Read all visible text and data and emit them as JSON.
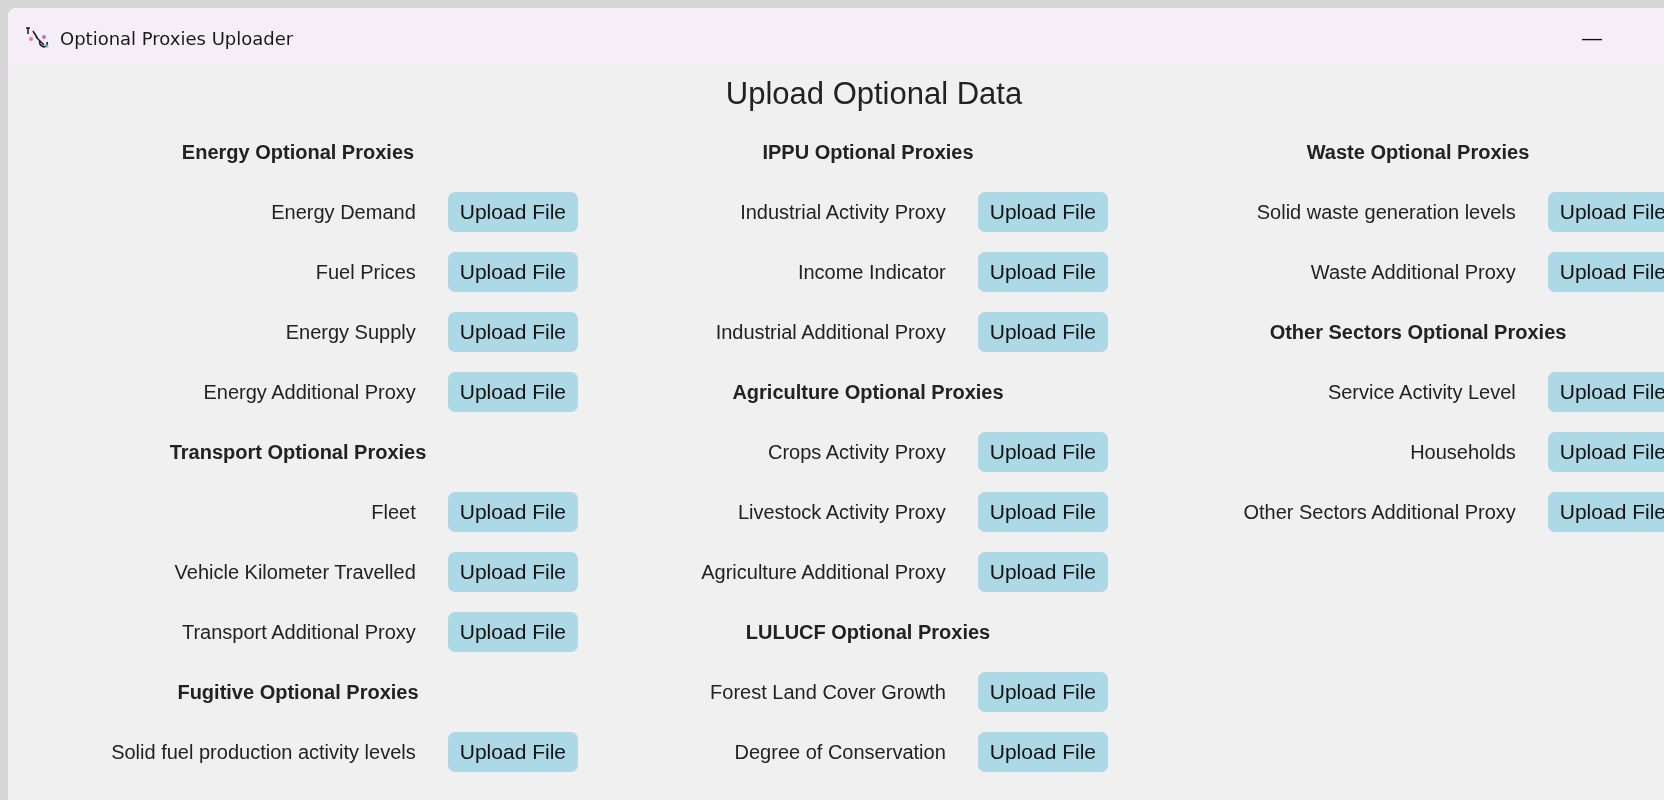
{
  "window": {
    "title": "Optional Proxies Uploader",
    "minimize_button": "—"
  },
  "heading": "Upload Optional Data",
  "columns": [
    [
      {
        "kind": "header",
        "text": "Energy Optional Proxies"
      },
      {
        "kind": "row",
        "label": "Energy Demand",
        "button": "Upload File"
      },
      {
        "kind": "row",
        "label": "Fuel Prices",
        "button": "Upload File"
      },
      {
        "kind": "row",
        "label": "Energy Supply",
        "button": "Upload File"
      },
      {
        "kind": "row",
        "label": "Energy Additional Proxy",
        "button": "Upload File"
      },
      {
        "kind": "header",
        "text": "Transport Optional Proxies"
      },
      {
        "kind": "row",
        "label": "Fleet",
        "button": "Upload File"
      },
      {
        "kind": "row",
        "label": "Vehicle Kilometer Travelled",
        "button": "Upload File"
      },
      {
        "kind": "row",
        "label": "Transport Additional Proxy",
        "button": "Upload File"
      },
      {
        "kind": "header",
        "text": "Fugitive Optional Proxies"
      },
      {
        "kind": "row",
        "label": "Solid fuel production activity levels",
        "button": "Upload File"
      }
    ],
    [
      {
        "kind": "header",
        "text": "IPPU Optional Proxies"
      },
      {
        "kind": "row",
        "label": "Industrial Activity Proxy",
        "button": "Upload File"
      },
      {
        "kind": "row",
        "label": "Income Indicator",
        "button": "Upload File"
      },
      {
        "kind": "row",
        "label": "Industrial Additional Proxy",
        "button": "Upload File"
      },
      {
        "kind": "header",
        "text": "Agriculture Optional Proxies"
      },
      {
        "kind": "row",
        "label": "Crops Activity Proxy",
        "button": "Upload File"
      },
      {
        "kind": "row",
        "label": "Livestock Activity Proxy",
        "button": "Upload File"
      },
      {
        "kind": "row",
        "label": "Agriculture Additional Proxy",
        "button": "Upload File"
      },
      {
        "kind": "header",
        "text": "LULUCF Optional Proxies"
      },
      {
        "kind": "row",
        "label": "Forest Land Cover Growth",
        "button": "Upload File"
      },
      {
        "kind": "row",
        "label": "Degree of Conservation",
        "button": "Upload File"
      }
    ],
    [
      {
        "kind": "header",
        "text": "Waste Optional Proxies"
      },
      {
        "kind": "row",
        "label": "Solid waste generation levels",
        "button": "Upload File"
      },
      {
        "kind": "row",
        "label": "Waste Additional Proxy",
        "button": "Upload File"
      },
      {
        "kind": "header",
        "text": "Other Sectors Optional Proxies"
      },
      {
        "kind": "row",
        "label": "Service Activity Level",
        "button": "Upload File"
      },
      {
        "kind": "row",
        "label": "Households",
        "button": "Upload File"
      },
      {
        "kind": "row",
        "label": "Other Sectors Additional Proxy",
        "button": "Upload File"
      }
    ]
  ]
}
